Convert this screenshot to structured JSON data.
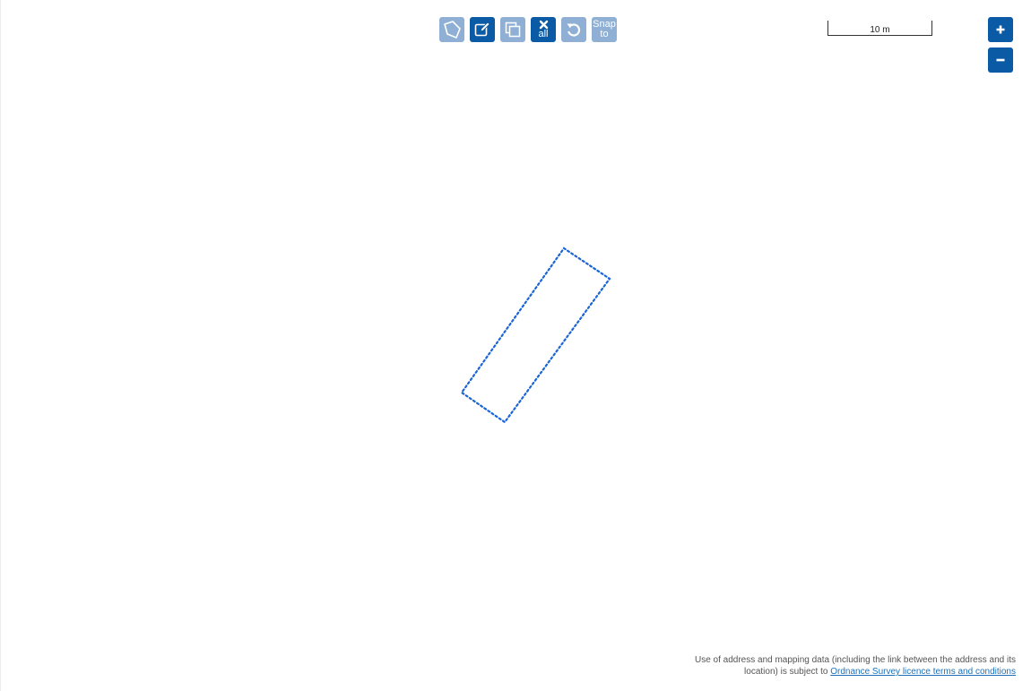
{
  "map": {
    "toolbar": {
      "draw": {
        "label": "Draw polygon",
        "icon": "polygon-icon",
        "enabled": false
      },
      "modify": {
        "label": "Modify",
        "icon": "edit-icon",
        "enabled": true
      },
      "copy": {
        "label": "Copy",
        "icon": "copy-icon",
        "enabled": false
      },
      "clear_all": {
        "label": "all",
        "icon": "close-icon",
        "enabled": true
      },
      "undo": {
        "label": "Undo",
        "icon": "undo-icon",
        "enabled": false
      },
      "snap": {
        "line1": "Snap",
        "line2": "to",
        "enabled": false
      }
    },
    "scale": {
      "label": "10 m"
    },
    "zoom": {
      "in": {
        "icon": "plus-icon"
      },
      "out": {
        "icon": "minus-icon"
      }
    },
    "feature": {
      "type": "polygon",
      "stroke_color": "#1a64d6",
      "style": "dotted"
    },
    "colors": {
      "button_enabled": "#0b5aa5",
      "button_disabled": "#8fb0d4",
      "link": "#1d70b8"
    },
    "attribution": {
      "text": "Use of address and mapping data (including the link between the address and its location) is subject to",
      "link_text": "Ordnance Survey licence terms and conditions"
    }
  }
}
